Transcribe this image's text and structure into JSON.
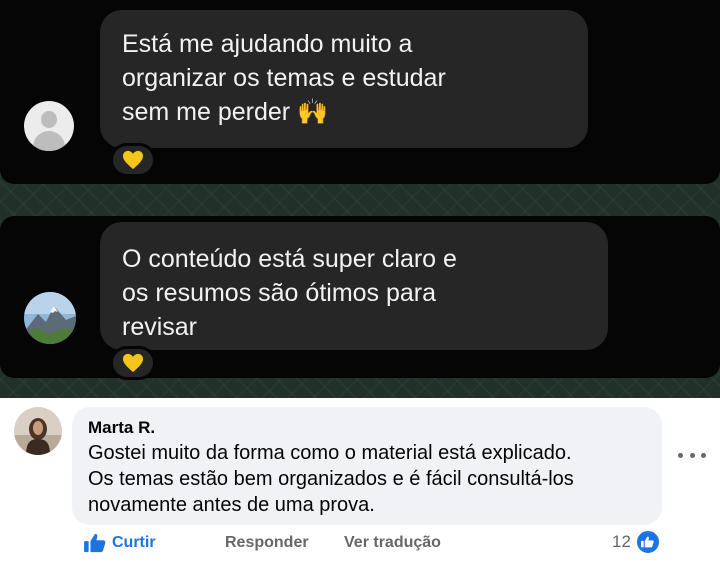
{
  "messages": [
    {
      "lines": [
        "Está me ajudando muito a",
        "organizar os temas e estudar",
        "sem me perder 🙌"
      ],
      "reaction": "yellow-heart",
      "avatar": "default-profile"
    },
    {
      "lines": [
        "O conteúdo está super claro e",
        "os resumos são ótimos para",
        "revisar"
      ],
      "reaction": "yellow-heart",
      "avatar": "mountain-photo"
    }
  ],
  "comment": {
    "author": "Marta R.",
    "lines": [
      "Gostei muito da forma como o material está explicado.",
      "Os temas estão bem organizados e é fácil consultá-los",
      "novamente antes de uma prova."
    ],
    "actions": {
      "like": "Curtir",
      "reply": "Responder",
      "translate": "Ver tradução"
    },
    "like_count": "12"
  },
  "colors": {
    "chat_bubble": "#262626",
    "heart": "#f5c518",
    "facebook_blue": "#1b74e4"
  }
}
